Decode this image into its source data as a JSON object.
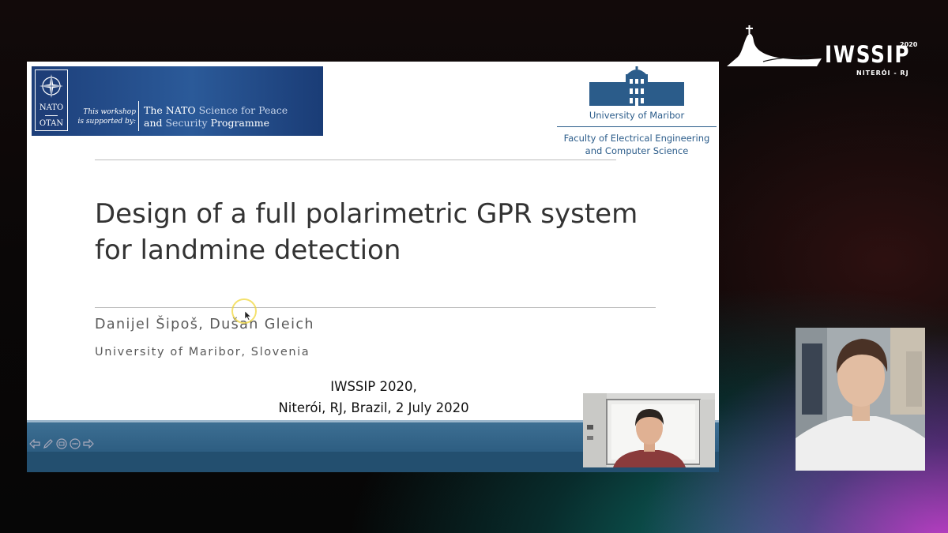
{
  "event": {
    "name": "IWSSIP",
    "year": "2020",
    "place": "NITERÓI - RJ"
  },
  "slide": {
    "banner": {
      "nato": "NATO",
      "otan": "OTAN",
      "supported_by_1": "This workshop",
      "supported_by_2": "is supported by:",
      "programme_line1_a": "The NATO ",
      "programme_line1_b": "Science for Peace",
      "programme_line2_a": "and ",
      "programme_line2_b": "Security ",
      "programme_line2_c": "Programme"
    },
    "university": {
      "name": "University of Maribor",
      "faculty_line1": "Faculty of Electrical Engineering",
      "faculty_line2": "and Computer Science"
    },
    "title_line1": "Design of a full polarimetric GPR system",
    "title_line2": "for landmine detection",
    "authors": "Danijel Šipoš, Dušan Gleich",
    "affiliation": "University of Maribor, Slovenia",
    "conference_line1": "IWSSIP 2020,",
    "conference_line2": "Niterói, RJ, Brazil, 2 July 2020"
  },
  "controls": [
    {
      "name": "previous-slide",
      "icon": "arrow-left-icon"
    },
    {
      "name": "pen",
      "icon": "pen-icon"
    },
    {
      "name": "slides",
      "icon": "slides-icon"
    },
    {
      "name": "more",
      "icon": "more-icon"
    },
    {
      "name": "next-slide",
      "icon": "arrow-right-icon"
    }
  ],
  "colors": {
    "nato_blue": "#1d3f7a",
    "maribor_blue": "#2b5c8a",
    "footer_blue": "#2c5c80",
    "title_gray": "#333333"
  }
}
